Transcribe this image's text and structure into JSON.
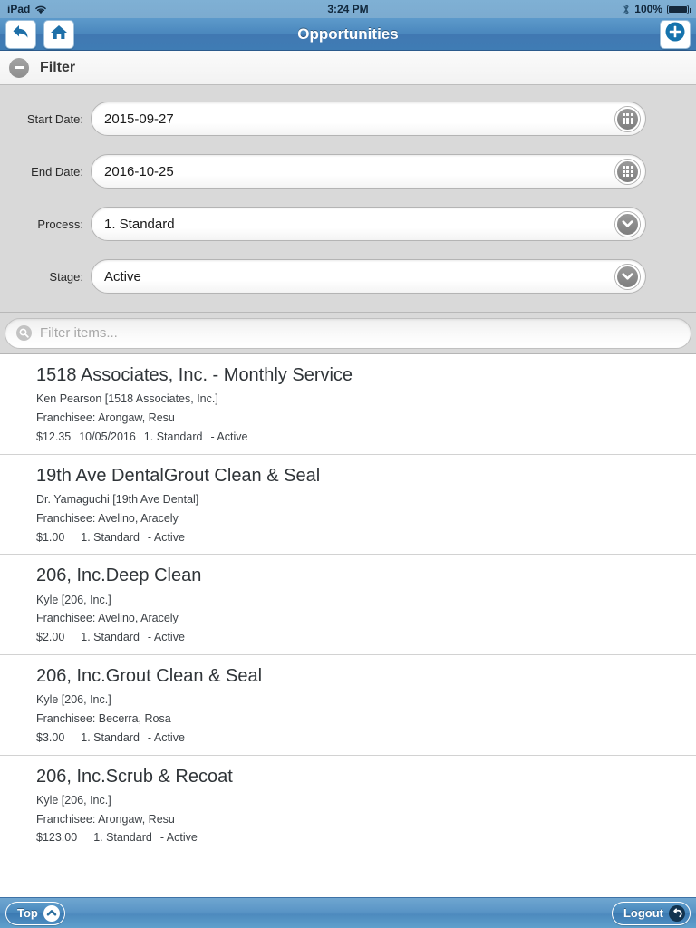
{
  "status_bar": {
    "device": "iPad",
    "wifi_icon": "wifi-icon",
    "time": "3:24 PM",
    "bluetooth_icon": "bluetooth-icon",
    "battery_percent": "100%",
    "battery_icon": "battery-full-icon"
  },
  "nav": {
    "title": "Opportunities",
    "back_icon": "back-arrow-icon",
    "home_icon": "home-icon",
    "add_icon": "add-circle-icon"
  },
  "filter_panel": {
    "header_label": "Filter",
    "collapse_icon": "minus-circle-icon",
    "fields": [
      {
        "label": "Start Date:",
        "value": "2015-09-27",
        "control": "date",
        "icon": "calendar-grid-icon"
      },
      {
        "label": "End Date:",
        "value": "2016-10-25",
        "control": "date",
        "icon": "calendar-grid-icon"
      },
      {
        "label": "Process:",
        "value": "1. Standard",
        "control": "select",
        "icon": "chevron-down-icon"
      },
      {
        "label": "Stage:",
        "value": "Active",
        "control": "select",
        "icon": "chevron-down-icon"
      }
    ]
  },
  "search": {
    "placeholder": "Filter items...",
    "value": "",
    "icon": "search-icon"
  },
  "list": {
    "items": [
      {
        "title": "1518 Associates, Inc. - Monthly Service",
        "contact": "Ken Pearson [1518 Associates, Inc.]",
        "franchisee": "Franchisee: Arongaw, Resu",
        "amount": "$12.35",
        "date": "10/05/2016",
        "process": "1. Standard",
        "stage": "- Active"
      },
      {
        "title": "19th Ave DentalGrout Clean & Seal",
        "contact": "Dr. Yamaguchi [19th Ave Dental]",
        "franchisee": "Franchisee: Avelino, Aracely",
        "amount": "$1.00",
        "date": "",
        "process": "1. Standard",
        "stage": "- Active"
      },
      {
        "title": "206, Inc.Deep Clean",
        "contact": "Kyle [206, Inc.]",
        "franchisee": "Franchisee: Avelino, Aracely",
        "amount": "$2.00",
        "date": "",
        "process": "1. Standard",
        "stage": "- Active"
      },
      {
        "title": "206, Inc.Grout Clean & Seal",
        "contact": "Kyle [206, Inc.]",
        "franchisee": "Franchisee: Becerra, Rosa",
        "amount": "$3.00",
        "date": "",
        "process": "1. Standard",
        "stage": "- Active"
      },
      {
        "title": "206, Inc.Scrub & Recoat",
        "contact": "Kyle [206, Inc.]",
        "franchisee": "Franchisee: Arongaw, Resu",
        "amount": "$123.00",
        "date": "",
        "process": "1. Standard",
        "stage": "- Active"
      }
    ]
  },
  "toolbar": {
    "top_label": "Top",
    "top_icon": "chevron-up-circle-icon",
    "logout_label": "Logout",
    "logout_icon": "logout-arrow-icon"
  },
  "colors": {
    "nav_blue": "#4a87bd",
    "toolbar_blue": "#5a95c6",
    "panel_gray": "#d9d9d9",
    "text_dark": "#2f3438"
  }
}
